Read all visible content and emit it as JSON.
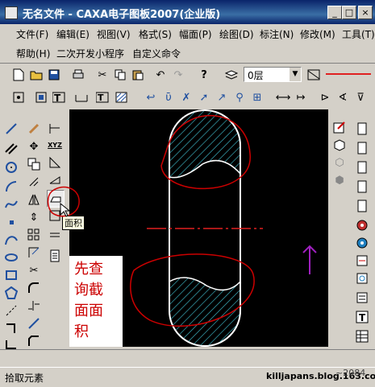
{
  "window": {
    "title": "无名文件 - CAXA电子图板2007(企业版)",
    "minimize_label": "_",
    "maximize_label": "□",
    "close_label": "×"
  },
  "menubar": {
    "row1": [
      "文件(F)",
      "编辑(E)",
      "视图(V)",
      "格式(S)",
      "幅面(P)",
      "绘图(D)",
      "标注(N)",
      "修改(M)",
      "工具(T)"
    ],
    "row2": [
      "帮助(H)",
      "二次开发小程序",
      "自定义命令"
    ]
  },
  "toolbar": {
    "layer_value": "0层"
  },
  "tooltip": {
    "text": "面积"
  },
  "annotation": {
    "lines": [
      "先查",
      "询截",
      "面面",
      "积"
    ],
    "color": "#cc0000"
  },
  "statusbar": {
    "left_text": "拾取元素",
    "right_text": "~2084",
    "watermark": "killjapans.blog.163.com"
  },
  "colors": {
    "titlebar": "#0a246a",
    "canvas_bg": "#000000",
    "hatch": "#3fb8c8",
    "outline": "#ffffff",
    "centerline": "#e02020",
    "annotation_red": "#cc0000",
    "arrow_purple": "#a020c0"
  }
}
